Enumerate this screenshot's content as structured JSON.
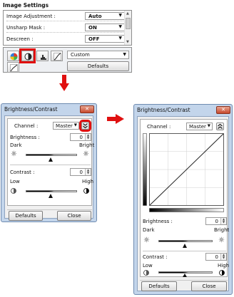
{
  "image_settings": {
    "title": "Image Settings",
    "rows": [
      {
        "label": "Image Adjustment :",
        "value": "Auto"
      },
      {
        "label": "Unsharp Mask :",
        "value": "ON"
      },
      {
        "label": "Descreen :",
        "value": "OFF"
      }
    ],
    "preset_value": "Custom",
    "defaults_label": "Defaults",
    "highlighted_tool": "brightness-contrast"
  },
  "small_dialog": {
    "title": "Brightness/Contrast",
    "close_glyph": "✕",
    "channel_label": "Channel :",
    "channel_value": "Master",
    "brightness_label": "Brightness :",
    "brightness_value": "0",
    "dark_label": "Dark",
    "bright_label": "Bright",
    "contrast_label": "Contrast :",
    "contrast_value": "0",
    "low_label": "Low",
    "high_label": "High",
    "defaults_label": "Defaults",
    "close_label": "Close"
  },
  "large_dialog": {
    "title": "Brightness/Contrast",
    "close_glyph": "✕",
    "channel_label": "Channel :",
    "channel_value": "Master",
    "brightness_label": "Brightness :",
    "brightness_value": "0",
    "dark_label": "Dark",
    "bright_label": "Bright",
    "contrast_label": "Contrast :",
    "contrast_value": "0",
    "low_label": "Low",
    "high_label": "High",
    "defaults_label": "Defaults",
    "close_label": "Close"
  },
  "colors": {
    "highlight": "#e01010",
    "titlebar": "#c3d5eb"
  }
}
